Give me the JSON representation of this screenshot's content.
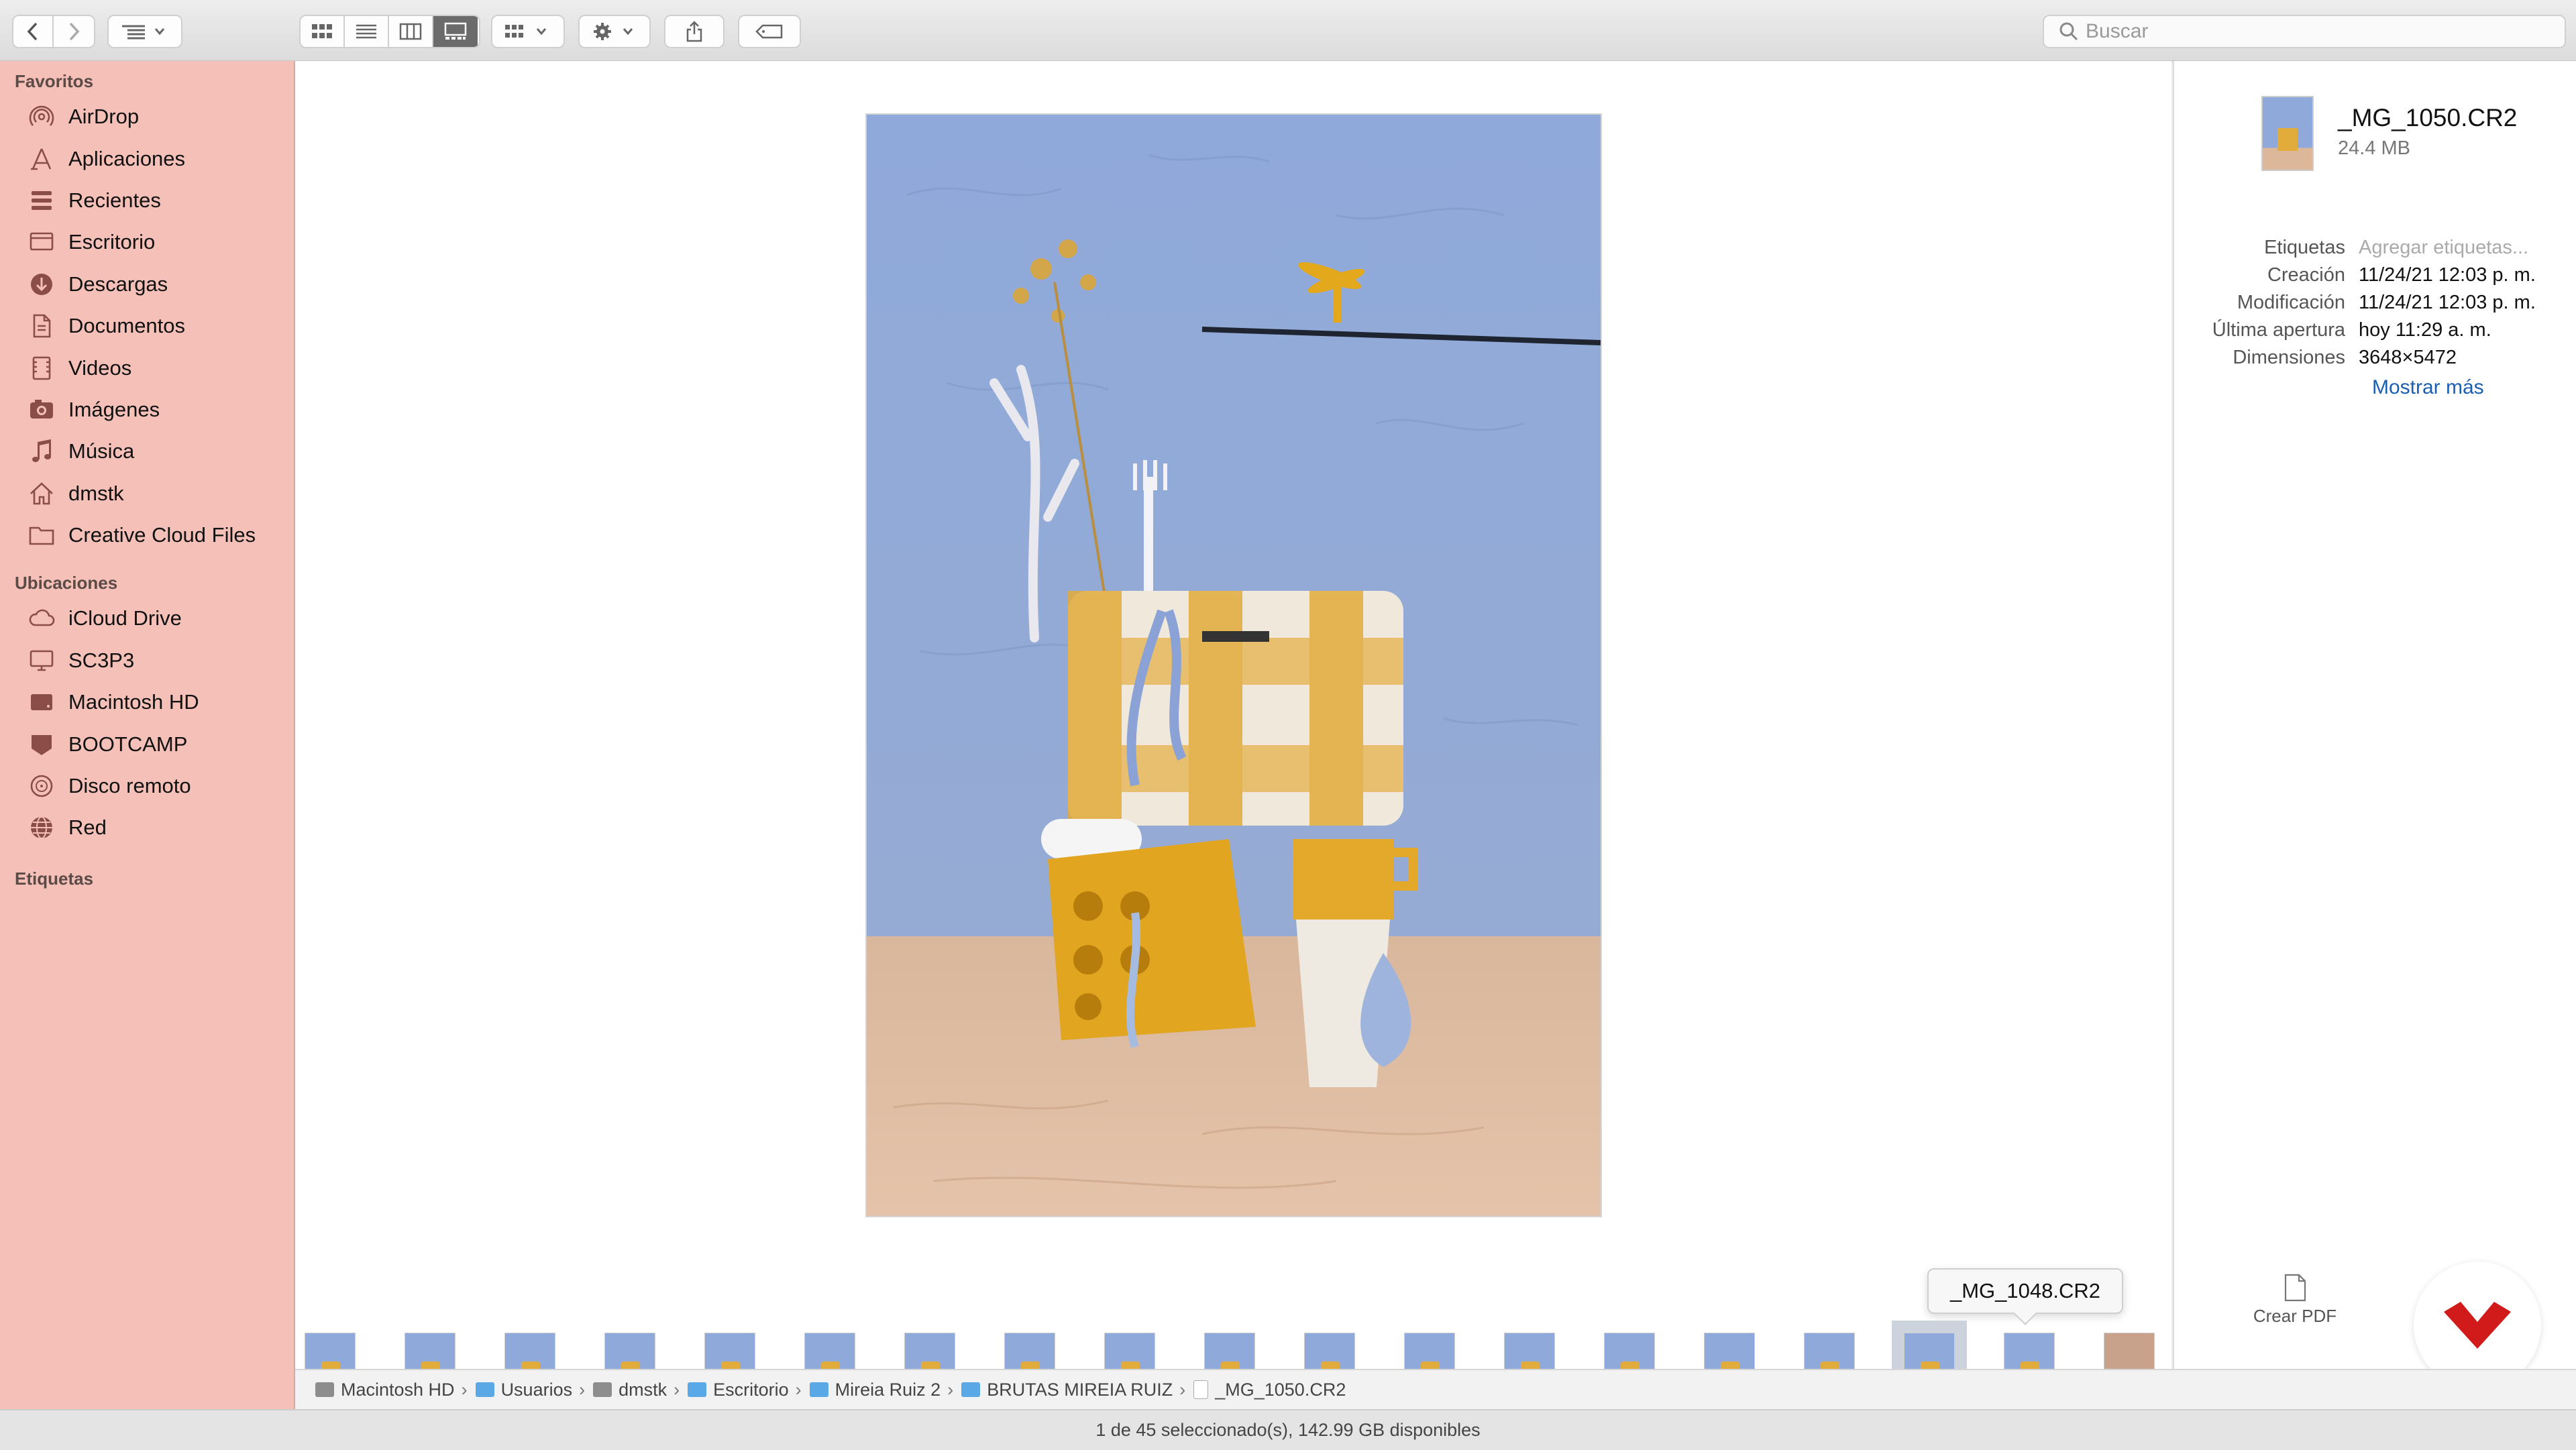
{
  "toolbar": {
    "search_placeholder": "Buscar",
    "view_modes": [
      "icon-view",
      "list-view",
      "column-view",
      "gallery-view"
    ],
    "active_view": "gallery-view"
  },
  "sidebar": {
    "favorites_header": "Favoritos",
    "favorites": [
      {
        "label": "AirDrop",
        "icon": "airdrop-icon"
      },
      {
        "label": "Aplicaciones",
        "icon": "applications-icon"
      },
      {
        "label": "Recientes",
        "icon": "recents-icon"
      },
      {
        "label": "Escritorio",
        "icon": "desktop-icon"
      },
      {
        "label": "Descargas",
        "icon": "downloads-icon"
      },
      {
        "label": "Documentos",
        "icon": "documents-icon"
      },
      {
        "label": "Videos",
        "icon": "videos-icon"
      },
      {
        "label": "Imágenes",
        "icon": "pictures-icon"
      },
      {
        "label": "Música",
        "icon": "music-icon"
      },
      {
        "label": "dmstk",
        "icon": "home-icon"
      },
      {
        "label": "Creative Cloud Files",
        "icon": "folder-icon"
      }
    ],
    "locations_header": "Ubicaciones",
    "locations": [
      {
        "label": "iCloud Drive",
        "icon": "cloud-icon"
      },
      {
        "label": "SC3P3",
        "icon": "computer-icon"
      },
      {
        "label": "Macintosh HD",
        "icon": "disk-icon"
      },
      {
        "label": "BOOTCAMP",
        "icon": "bootcamp-disk-icon"
      },
      {
        "label": "Disco remoto",
        "icon": "remote-disc-icon"
      },
      {
        "label": "Red",
        "icon": "network-icon"
      }
    ],
    "tags_header": "Etiquetas"
  },
  "info": {
    "filename": "_MG_1050.CR2",
    "size": "24.4 MB",
    "rows": [
      {
        "key": "Etiquetas",
        "value": "Agregar etiquetas..."
      },
      {
        "key": "Creación",
        "value": "11/24/21 12:03 p. m."
      },
      {
        "key": "Modificación",
        "value": "11/24/21 12:03 p. m."
      },
      {
        "key": "Última apertura",
        "value": "hoy 11:29 a. m."
      },
      {
        "key": "Dimensiones",
        "value": "3648×5472"
      }
    ],
    "show_more": "Mostrar más",
    "create_pdf": "Crear PDF"
  },
  "tooltip": "_MG_1048.CR2",
  "thumbnails_count": 19,
  "selected_thumbnail_index": 16,
  "pathbar": [
    {
      "label": "Macintosh HD",
      "icon": "disk-icon"
    },
    {
      "label": "Usuarios",
      "icon": "folder-icon"
    },
    {
      "label": "dmstk",
      "icon": "home-icon"
    },
    {
      "label": "Escritorio",
      "icon": "folder-icon"
    },
    {
      "label": "Mireia Ruiz 2",
      "icon": "folder-icon"
    },
    {
      "label": "BRUTAS MIREIA RUIZ",
      "icon": "folder-icon"
    },
    {
      "label": "_MG_1050.CR2",
      "icon": "file-icon"
    }
  ],
  "status": "1 de 45 seleccionado(s), 142.99 GB disponibles",
  "colors": {
    "sidebar_bg": "#f4c0b8",
    "link": "#1a5fb4",
    "photo_wall": "#8fa8d8",
    "photo_floor": "#dcb79a",
    "mustard": "#e2a621"
  }
}
